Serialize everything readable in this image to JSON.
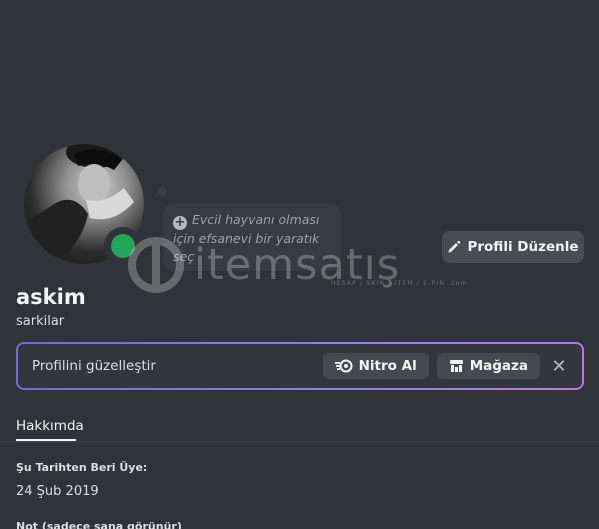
{
  "profile": {
    "username": "askim",
    "tagline": "sarkilar",
    "status": "online",
    "status_color": "#23a55a"
  },
  "pet_bubble": {
    "text": "Evcil hayvanı olması için efsanevi bir yaratık seç"
  },
  "buttons": {
    "edit_profile": "Profili Düzenle"
  },
  "nitro_banner": {
    "text": "Profilini güzelleştir",
    "nitro_label": "Nitro Al",
    "shop_label": "Mağaza",
    "close_glyph": "✕"
  },
  "tabs": {
    "about": "Hakkımda"
  },
  "about": {
    "member_since_label": "Şu Tarihten Beri Üye:",
    "member_since_value": "24 Şub 2019",
    "note_label": "Not (sadece sana görünür)"
  },
  "watermark": {
    "brand": "itemsatış",
    "sub": "HESAP / SKIN / ITEM / E-PIN",
    "suffix": ".com"
  },
  "colors": {
    "background": "#323339",
    "accent_gradient_start": "#6f6cdf",
    "accent_gradient_end": "#b07be8"
  }
}
